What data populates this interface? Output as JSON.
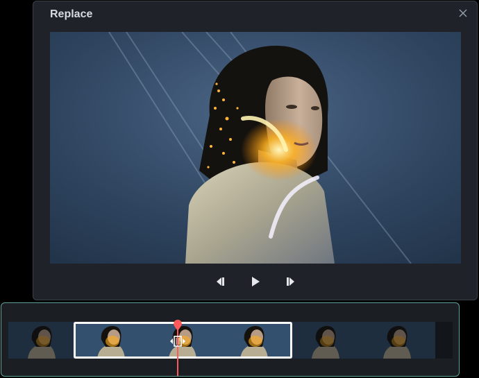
{
  "dialog": {
    "title": "Replace",
    "close_icon": "close-icon"
  },
  "player": {
    "controls": [
      {
        "name": "step-back-button",
        "icon": "step-back-icon"
      },
      {
        "name": "play-button",
        "icon": "play-icon"
      },
      {
        "name": "step-forward-button",
        "icon": "step-forward-icon"
      }
    ]
  },
  "timeline": {
    "frame_count": 6,
    "selected_frames": [
      2,
      3,
      4
    ],
    "playhead_icon": "playhead-icon",
    "split_icon": "split-handle-icon"
  },
  "colors": {
    "dialog_bg": "#1f2329",
    "timeline_border": "#5fa39a",
    "selection_border": "#ffffff",
    "playhead": "#ff5a5a"
  }
}
